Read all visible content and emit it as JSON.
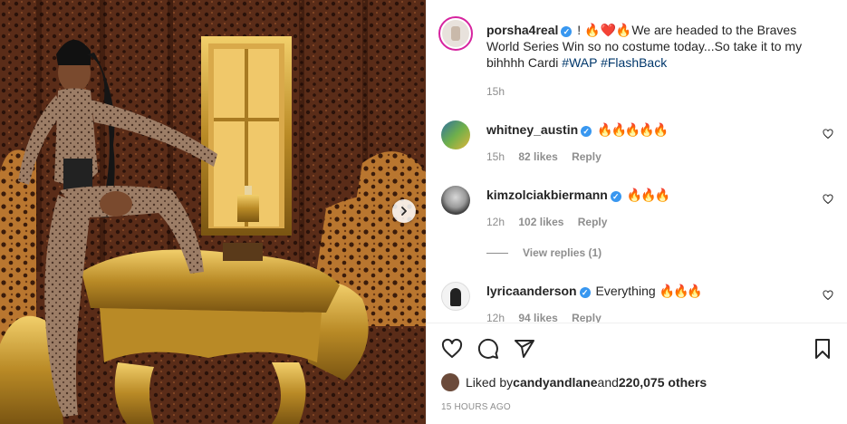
{
  "post": {
    "author": "porsha4real",
    "caption_prefix": "! ",
    "caption_emoji": "🔥❤️🔥",
    "caption_text": "We are headed to the Braves World Series Win so no costume today...So take it to my bihhhh Cardi ",
    "hashtags": [
      "#WAP",
      "#FlashBack"
    ],
    "age": "15h"
  },
  "comments": [
    {
      "user": "whitney_austin",
      "text": "🔥🔥🔥🔥🔥",
      "age": "15h",
      "likes": "82 likes",
      "reply": "Reply"
    },
    {
      "user": "kimzolciakbiermann",
      "text": "🔥🔥🔥",
      "age": "12h",
      "likes": "102 likes",
      "reply": "Reply",
      "view_replies": "View replies (1)"
    },
    {
      "user": "lyricaanderson",
      "text": "Everything ",
      "text_emoji": "🔥🔥🔥",
      "age": "12h",
      "likes": "94 likes",
      "reply": "Reply"
    }
  ],
  "likes_line": {
    "prefix": "Liked by ",
    "user": "candyandlane",
    "middle": " and ",
    "count": "220,075 others"
  },
  "timestamp": "15 HOURS AGO",
  "icons": [
    "heart-icon",
    "comment-icon",
    "share-icon",
    "bookmark-icon",
    "chevron-right-icon",
    "verified-icon"
  ],
  "colors": {
    "verified": "#3897f0",
    "hashtag": "#00376b",
    "muted": "#8e8e8e",
    "text": "#262626"
  }
}
